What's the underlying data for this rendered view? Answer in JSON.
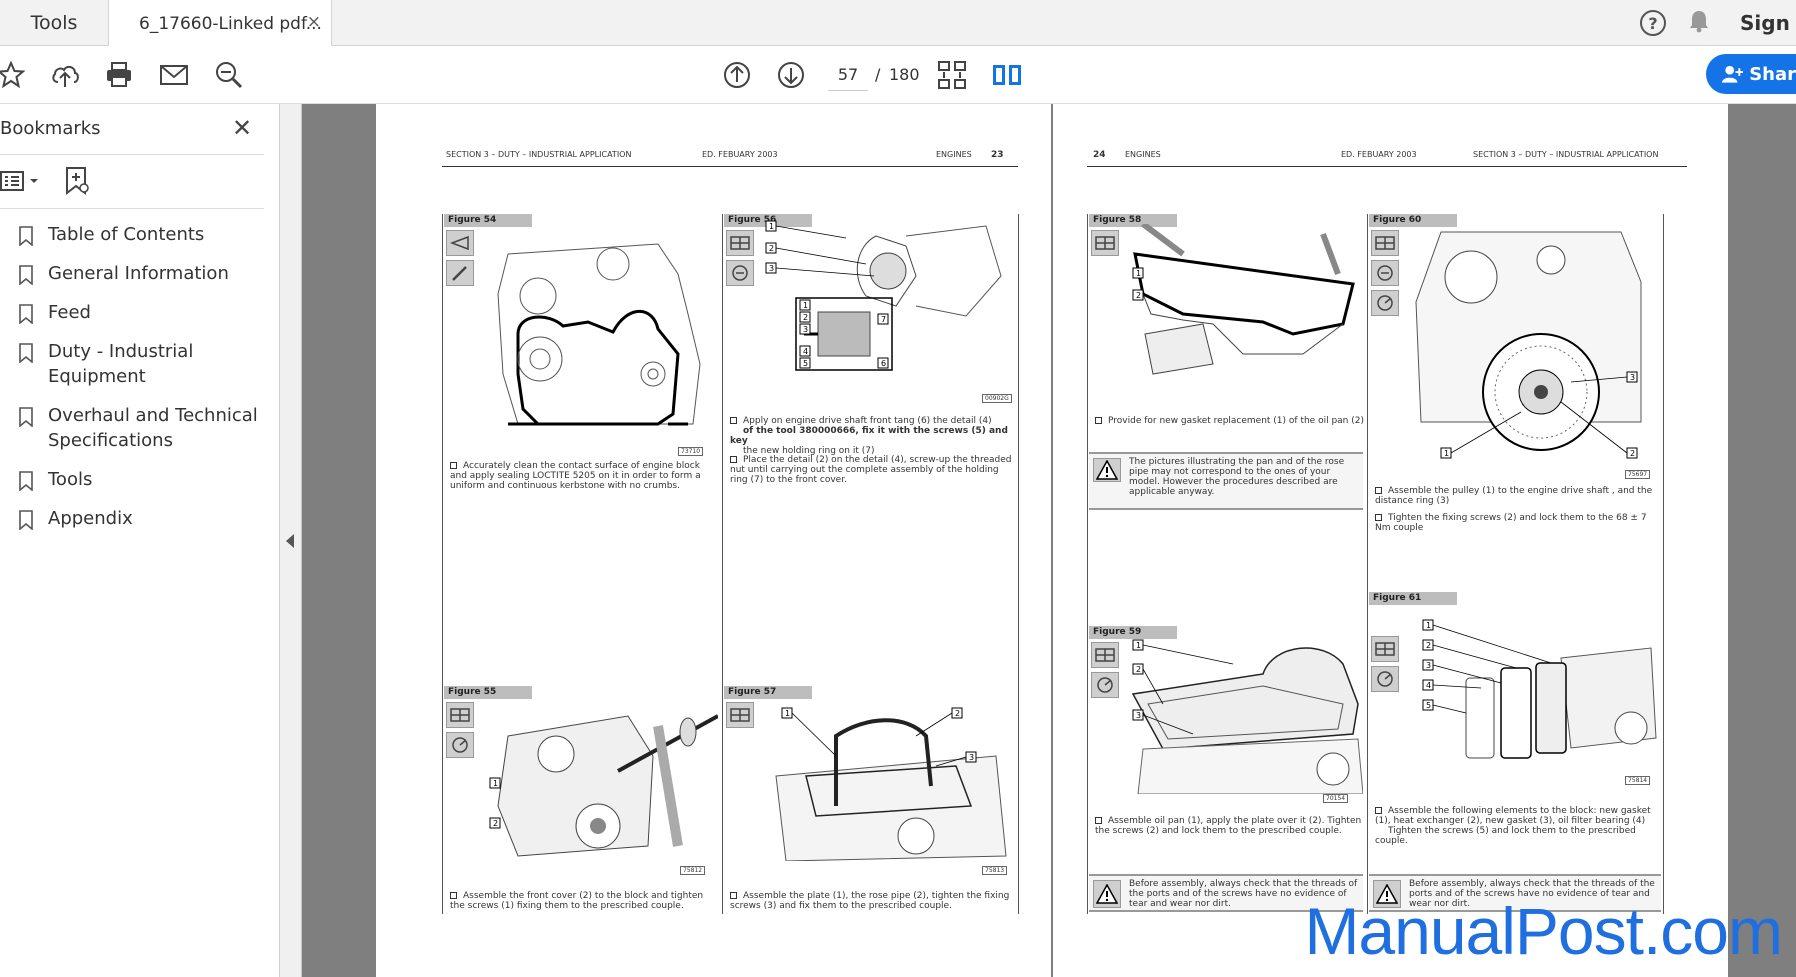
{
  "tabs": {
    "tools_label": "Tools",
    "doc_title": "6_17660-Linked pdf...",
    "close_label": "×"
  },
  "top_right": {
    "help_label": "?",
    "sign_label": "Sign"
  },
  "toolbar": {
    "page_current": "57",
    "page_separator": "/",
    "page_total": "180",
    "share_label": "Shar"
  },
  "sidebar": {
    "title": "Bookmarks",
    "close_label": "✕",
    "bookmarks": [
      {
        "label": "Table of Contents"
      },
      {
        "label": "General Information"
      },
      {
        "label": "Feed"
      },
      {
        "label": "Duty - Industrial Equipment"
      },
      {
        "label": "Overhaul and Technical Specifications"
      },
      {
        "label": "Tools"
      },
      {
        "label": "Appendix"
      }
    ]
  },
  "page_left": {
    "header_section": "SECTION 3 – DUTY – INDUSTRIAL APPLICATION",
    "header_edition": "ED. FEBUARY 2003",
    "header_engines": "ENGINES",
    "header_page": "23",
    "figures": {
      "fig54": {
        "label": "Figure 54",
        "code": "73710",
        "caption": "Accurately clean the contact surface of engine block and apply sealing LOCTITE 5205 on it in order to form a uniform and continuous kerbstone with no crumbs."
      },
      "fig55": {
        "label": "Figure 55",
        "code": "75812",
        "caption": "Assemble the front cover (2) to the block and tighten the screws (1) fixing them to the prescribed couple."
      },
      "fig56": {
        "label": "Figure 56",
        "code": "00902G",
        "caption1_a": "Apply on engine drive shaft front tang (6) the detail (4)",
        "caption1_b": "of the tool 380000666, fix it with the screws (5) and key",
        "caption1_c": "the new holding ring on it (7)",
        "caption2": "Place the detail (2) on the detail (4), screw-up the threaded nut until carrying out the complete assembly of the holding ring (7) to the front cover."
      },
      "fig57": {
        "label": "Figure 57",
        "code": "75813",
        "caption": "Assemble the plate (1), the rose pipe (2), tighten the fixing screws (3) and fix them to the prescribed couple."
      }
    }
  },
  "page_right": {
    "header_page": "24",
    "header_engines": "ENGINES",
    "header_edition": "ED. FEBUARY 2003",
    "header_section": "SECTION 3 – DUTY – INDUSTRIAL APPLICATION",
    "figures": {
      "fig58": {
        "label": "Figure 58",
        "caption": "Provide for new gasket replacement (1) of the oil pan (2)",
        "warning": "The pictures illustrating the pan and of the rose pipe may not correspond to the ones of your model. However the procedures described are applicable anyway."
      },
      "fig59": {
        "label": "Figure 59",
        "code": "70154",
        "caption": "Assemble oil pan (1), apply the plate over it (2). Tighten the screws (2) and lock them to the prescribed couple.",
        "warning": "Before assembly, always check that the threads of the ports and of the screws have no evidence of tear and wear nor dirt."
      },
      "fig60": {
        "label": "Figure 60",
        "code": "75697",
        "caption1": "Assemble the pulley (1) to the engine drive shaft , and the distance ring (3)",
        "caption2": "Tighten the fixing screws (2) and lock them to the 68 ± 7 Nm couple"
      },
      "fig61": {
        "label": "Figure 61",
        "code": "75814",
        "caption_a": "Assemble the following elements to the block: new gasket (1), heat exchanger (2), new gasket (3), oil filter bearing (4)",
        "caption_b": "Tighten the screws (5) and lock them to the prescribed couple.",
        "warning": "Before assembly, always check that the threads of the ports and of the screws have no evidence of tear and wear nor dirt."
      }
    }
  },
  "watermark": "ManualPost.com",
  "colors": {
    "accent": "#1473e6",
    "canvas_bg": "#7f7f7f",
    "watermark": "#1f6fe0"
  }
}
